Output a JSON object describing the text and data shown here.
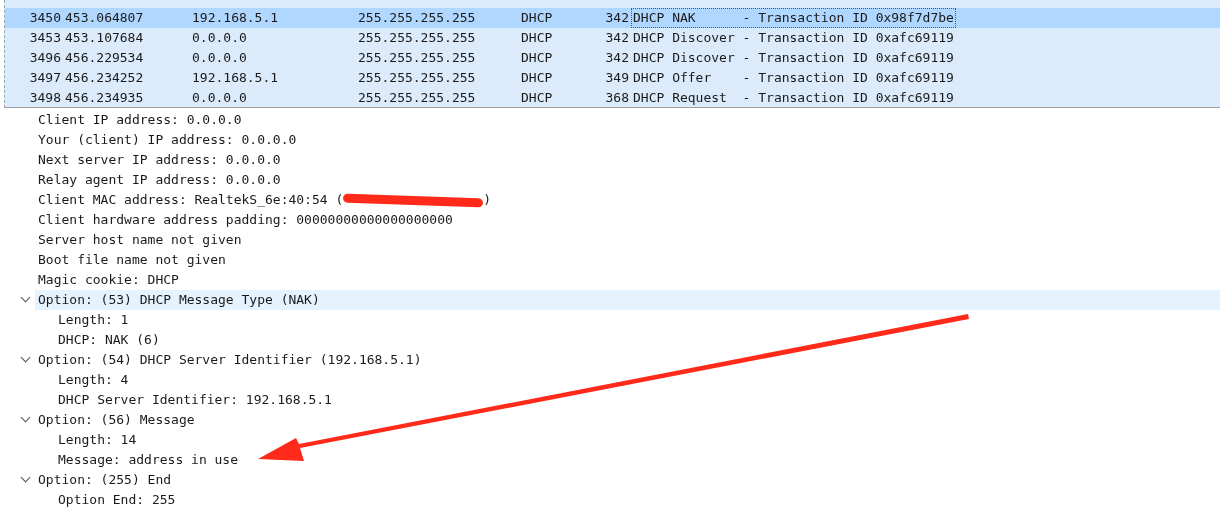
{
  "packet_list": {
    "rows": [
      {
        "no": "3450",
        "time": "453.064807",
        "source": "192.168.5.1",
        "destination": "255.255.255.255",
        "protocol": "DHCP",
        "length": "342",
        "info": "DHCP NAK      - Transaction ID 0x98f7d7be",
        "selected": true
      },
      {
        "no": "3453",
        "time": "453.107684",
        "source": "0.0.0.0",
        "destination": "255.255.255.255",
        "protocol": "DHCP",
        "length": "342",
        "info": "DHCP Discover - Transaction ID 0xafc69119",
        "selected": false
      },
      {
        "no": "3496",
        "time": "456.229534",
        "source": "0.0.0.0",
        "destination": "255.255.255.255",
        "protocol": "DHCP",
        "length": "342",
        "info": "DHCP Discover - Transaction ID 0xafc69119",
        "selected": false
      },
      {
        "no": "3497",
        "time": "456.234252",
        "source": "192.168.5.1",
        "destination": "255.255.255.255",
        "protocol": "DHCP",
        "length": "349",
        "info": "DHCP Offer    - Transaction ID 0xafc69119",
        "selected": false
      },
      {
        "no": "3498",
        "time": "456.234935",
        "source": "0.0.0.0",
        "destination": "255.255.255.255",
        "protocol": "DHCP",
        "length": "368",
        "info": "DHCP Request  - Transaction ID 0xafc69119",
        "selected": false
      }
    ]
  },
  "packet_details": {
    "items": [
      {
        "kind": "leaf",
        "text": "Client IP address: 0.0.0.0",
        "selected": false
      },
      {
        "kind": "leaf",
        "text": "Your (client) IP address: 0.0.0.0",
        "selected": false
      },
      {
        "kind": "leaf",
        "text": "Next server IP address: 0.0.0.0",
        "selected": false
      },
      {
        "kind": "leaf",
        "text": "Relay agent IP address: 0.0.0.0",
        "selected": false
      },
      {
        "kind": "redacted",
        "text": "Client MAC address: RealtekS_6e:40:54 (",
        "text_end": ")",
        "selected": false
      },
      {
        "kind": "leaf",
        "text": "Client hardware address padding: 00000000000000000000",
        "selected": false
      },
      {
        "kind": "leaf",
        "text": "Server host name not given",
        "selected": false
      },
      {
        "kind": "leaf",
        "text": "Boot file name not given",
        "selected": false
      },
      {
        "kind": "leaf",
        "text": "Magic cookie: DHCP",
        "selected": false
      },
      {
        "kind": "branch",
        "text": "Option: (53) DHCP Message Type (NAK)",
        "selected": true,
        "expanded": true,
        "children": [
          {
            "kind": "leaf",
            "text": "Length: 1",
            "selected": false
          },
          {
            "kind": "leaf",
            "text": "DHCP: NAK (6)",
            "selected": false
          }
        ]
      },
      {
        "kind": "branch",
        "text": "Option: (54) DHCP Server Identifier (192.168.5.1)",
        "selected": false,
        "expanded": true,
        "children": [
          {
            "kind": "leaf",
            "text": "Length: 4",
            "selected": false
          },
          {
            "kind": "leaf",
            "text": "DHCP Server Identifier: 192.168.5.1",
            "selected": false
          }
        ]
      },
      {
        "kind": "branch",
        "text": "Option: (56) Message",
        "selected": false,
        "expanded": true,
        "children": [
          {
            "kind": "leaf",
            "text": "Length: 14",
            "selected": false
          },
          {
            "kind": "leaf",
            "text": "Message: address in use",
            "selected": false
          }
        ]
      },
      {
        "kind": "branch",
        "text": "Option: (255) End",
        "selected": false,
        "expanded": true,
        "children": [
          {
            "kind": "leaf",
            "text": "Option End: 255",
            "selected": false
          }
        ]
      }
    ]
  }
}
